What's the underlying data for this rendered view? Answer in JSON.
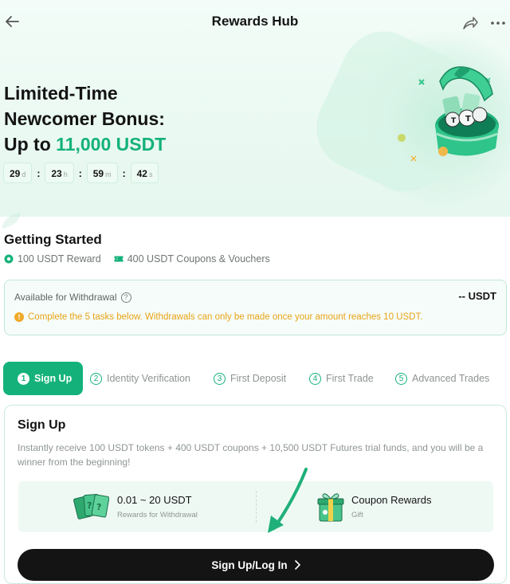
{
  "header": {
    "title": "Rewards Hub"
  },
  "hero": {
    "line1": "Limited-Time",
    "line2": "Newcomer Bonus:",
    "line3_prefix": "Up to ",
    "line3_highlight": "11,000 USDT",
    "countdown": [
      {
        "value": "29",
        "unit": "d"
      },
      {
        "value": "23",
        "unit": "h"
      },
      {
        "value": "59",
        "unit": "m"
      },
      {
        "value": "42",
        "unit": "s"
      }
    ],
    "separator": ":"
  },
  "getting_started": {
    "title": "Getting Started",
    "reward_label": "100 USDT Reward",
    "coupons_label": "400 USDT Coupons & Vouchers"
  },
  "withdrawal": {
    "label": "Available for Withdrawal",
    "help": "?",
    "value": "-- USDT",
    "note": "Complete the 5 tasks below. Withdrawals can only be made once your amount reaches 10 USDT."
  },
  "tabs": [
    {
      "num": "1",
      "label": "Sign Up",
      "active": true
    },
    {
      "num": "2",
      "label": "Identity Verification"
    },
    {
      "num": "3",
      "label": "First Deposit"
    },
    {
      "num": "4",
      "label": "First Trade"
    },
    {
      "num": "5",
      "label": "Advanced Trades"
    }
  ],
  "signup_panel": {
    "title": "Sign Up",
    "description": "Instantly receive 100 USDT tokens + 400 USDT coupons + 10,500 USDT Futures trial funds, and you will be a winner from the beginning!",
    "reward1_main": "0.01 ~ 20 USDT",
    "reward1_sub": "Rewards for Withdrawal",
    "reward2_main": "Coupon Rewards",
    "reward2_sub": "Gift",
    "cta_label": "Sign Up/Log In"
  },
  "colors": {
    "accent": "#14b27a",
    "warning": "#e8a316",
    "cta_bg": "#141414"
  }
}
